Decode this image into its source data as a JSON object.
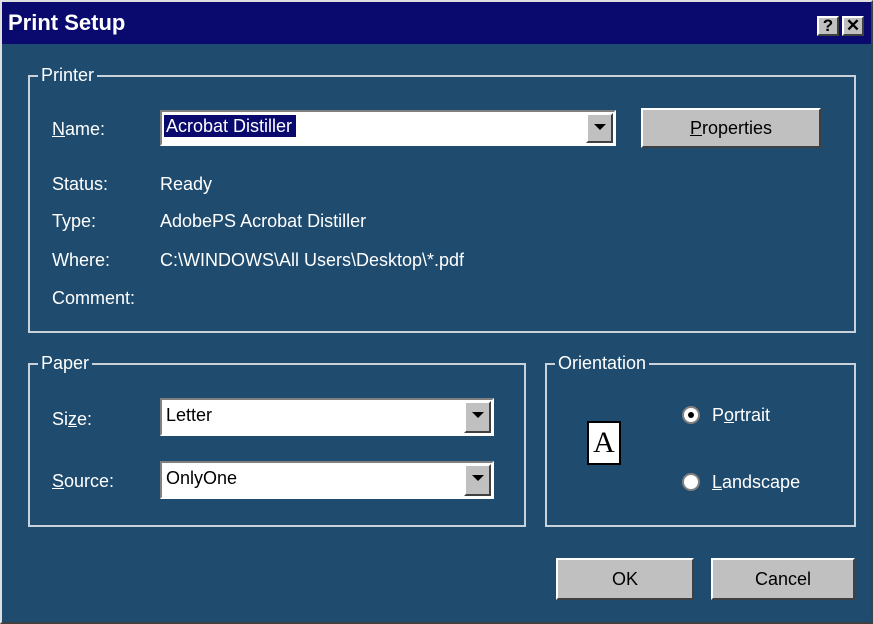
{
  "window": {
    "title": "Print Setup",
    "help_button": "?",
    "close_button": "✕"
  },
  "printer": {
    "legend": "Printer",
    "name_label": "Name:",
    "name_value": "Acrobat Distiller",
    "properties_button": "Properties",
    "status_label": "Status:",
    "status_value": "Ready",
    "type_label": "Type:",
    "type_value": "AdobePS Acrobat Distiller",
    "where_label": "Where:",
    "where_value": "C:\\WINDOWS\\All Users\\Desktop\\*.pdf",
    "comment_label": "Comment:",
    "comment_value": ""
  },
  "paper": {
    "legend": "Paper",
    "size_label": "Size:",
    "size_value": "Letter",
    "source_label": "Source:",
    "source_value": "OnlyOne"
  },
  "orientation": {
    "legend": "Orientation",
    "icon_letter": "A",
    "portrait_label": "Portrait",
    "landscape_label": "Landscape",
    "selected": "Portrait"
  },
  "footer": {
    "ok_label": "OK",
    "cancel_label": "Cancel"
  },
  "colors": {
    "title_bar": "#0a0a6e",
    "dialog_bg": "#1e4b6e",
    "button_face": "#c0c0c0"
  }
}
